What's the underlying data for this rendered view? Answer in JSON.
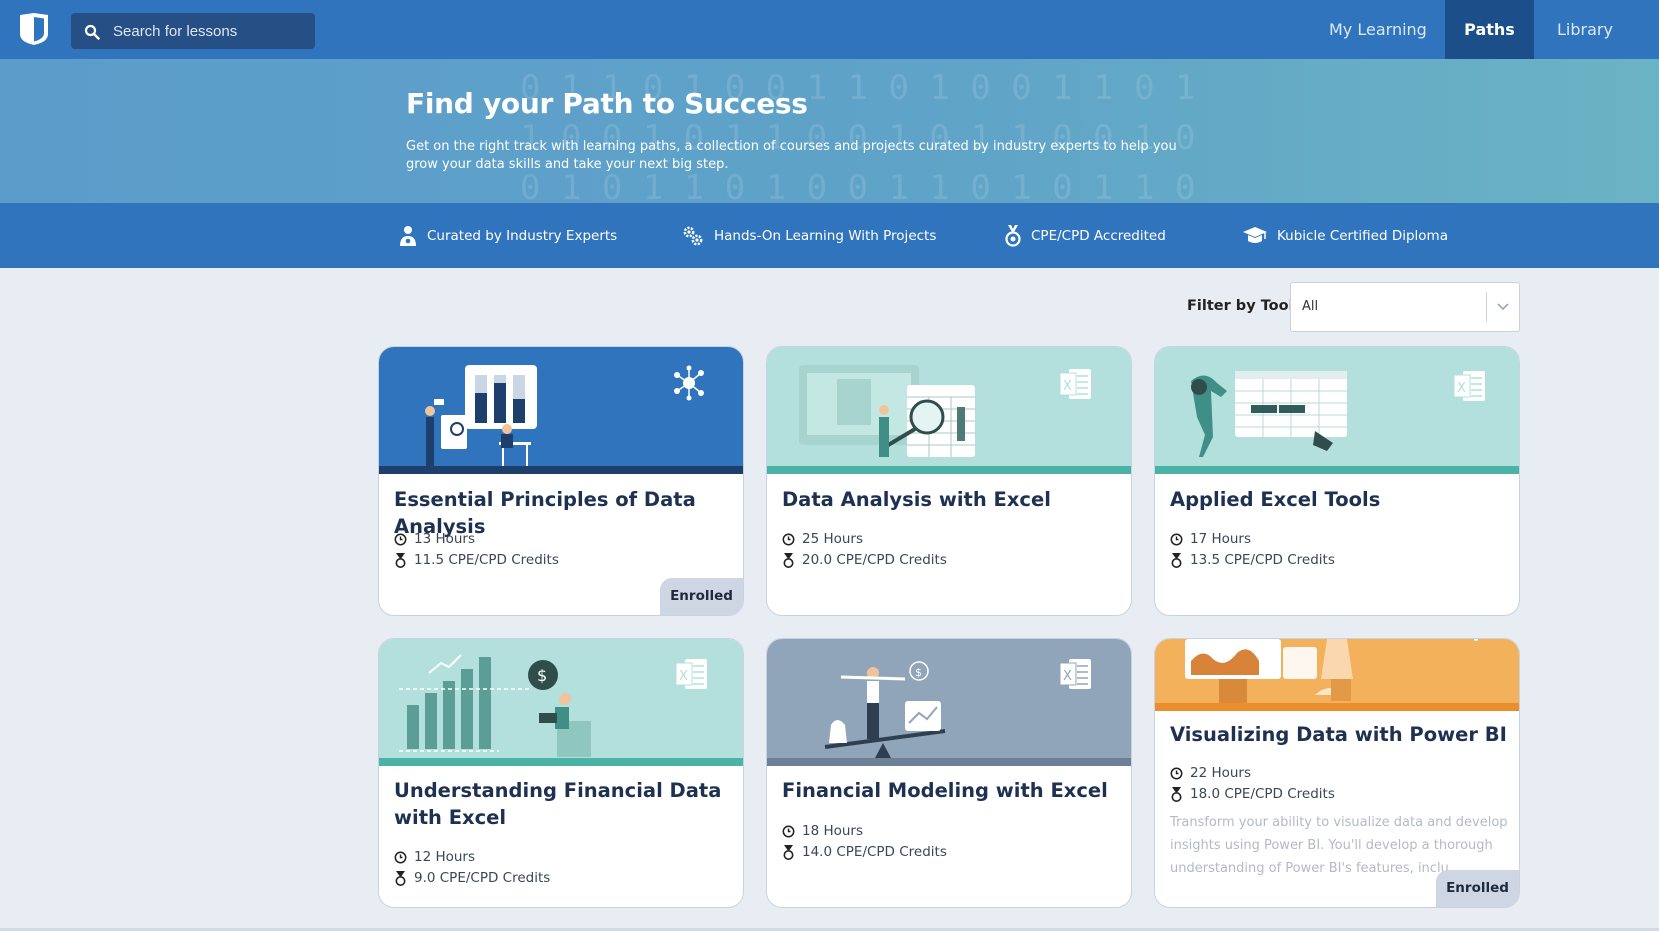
{
  "nav": {
    "search_placeholder": "Search for lessons",
    "items": [
      {
        "label": "My Learning",
        "active": false
      },
      {
        "label": "Paths",
        "active": true
      },
      {
        "label": "Library",
        "active": false
      }
    ]
  },
  "hero": {
    "title": "Find your Path to Success",
    "subtitle": "Get on the right track with learning paths, a collection of courses and projects curated by industry experts to help you grow your data skills and take your next big step."
  },
  "features": [
    {
      "icon": "expert-icon",
      "label": "Curated by Industry Experts"
    },
    {
      "icon": "gears-icon",
      "label": "Hands-On Learning With Projects"
    },
    {
      "icon": "medal-icon",
      "label": "CPE/CPD Accredited"
    },
    {
      "icon": "graduation-cap-icon",
      "label": "Kubicle Certified Diploma"
    }
  ],
  "filter": {
    "label": "Filter by Tool:",
    "selected": "All"
  },
  "cards": [
    {
      "title": "Essential Principles of Data Analysis",
      "hours": "13 Hours",
      "credits": "11.5 CPE/CPD Credits",
      "badge": "Enrolled",
      "tool_icon": "network-icon",
      "banner_color": "#3174be"
    },
    {
      "title": "Data Analysis with Excel",
      "hours": "25 Hours",
      "credits": "20.0 CPE/CPD Credits",
      "badge": "",
      "tool_icon": "excel-icon",
      "banner_color": "#b3e0dc"
    },
    {
      "title": "Applied Excel Tools",
      "hours": "17 Hours",
      "credits": "13.5 CPE/CPD Credits",
      "badge": "",
      "tool_icon": "excel-icon",
      "banner_color": "#b3e0dc"
    },
    {
      "title": "Understanding Financial Data with Excel",
      "hours": "12 Hours",
      "credits": "9.0 CPE/CPD Credits",
      "badge": "",
      "tool_icon": "excel-icon",
      "banner_color": "#b3e0dc"
    },
    {
      "title": "Financial Modeling with Excel",
      "hours": "18 Hours",
      "credits": "14.0 CPE/CPD Credits",
      "badge": "",
      "tool_icon": "excel-icon",
      "banner_color": "#91a5ba"
    },
    {
      "title": "Visualizing Data with Power BI",
      "hours": "22 Hours",
      "credits": "18.0 CPE/CPD Credits",
      "description": "Transform your ability to visualize data and develop insights using Power BI. You'll develop a thorough understanding of Power BI's features, inclu",
      "badge": "Enrolled",
      "tool_icon": "power-bi-icon",
      "banner_color": "#f2b15a"
    }
  ]
}
